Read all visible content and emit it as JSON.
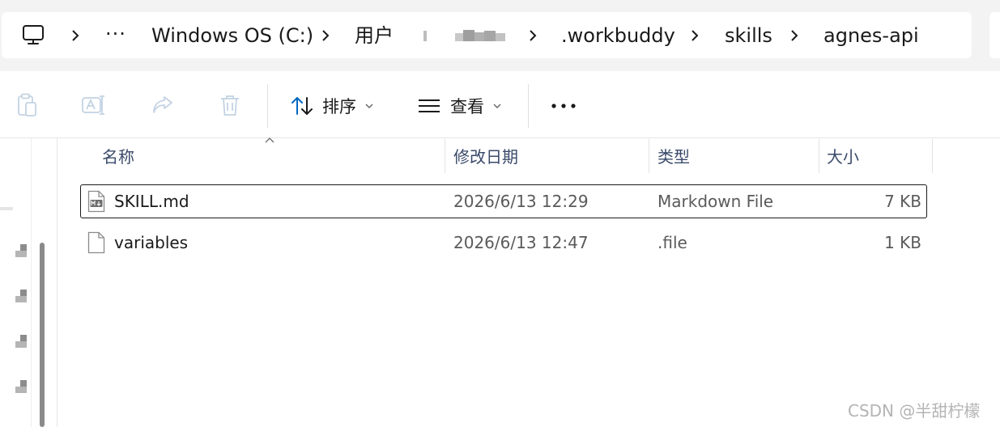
{
  "address": {
    "crumbs": {
      "drive": "Windows OS (C:)",
      "users": "用户",
      "workbuddy": ".workbuddy",
      "skills": "skills",
      "current": "agnes-api"
    }
  },
  "toolbar": {
    "sort_label": "排序",
    "view_label": "查看"
  },
  "file_list": {
    "columns": {
      "name": "名称",
      "modified": "修改日期",
      "type": "类型",
      "size": "大小"
    },
    "sorted_by": "name",
    "rows": [
      {
        "name": "SKILL.md",
        "modified": "2026/6/13 12:29",
        "type": "Markdown File",
        "size": "7 KB",
        "icon": "markdown-file-icon",
        "selected": true
      },
      {
        "name": "variables",
        "modified": "2026/6/13 12:47",
        "type": ".file",
        "size": "1 KB",
        "icon": "generic-file-icon",
        "selected": false
      }
    ]
  },
  "watermark": "CSDN @半甜柠檬",
  "colors": {
    "band": "#f3f3f3",
    "header_text": "#3a4a6a",
    "accent": "#0067c0"
  }
}
